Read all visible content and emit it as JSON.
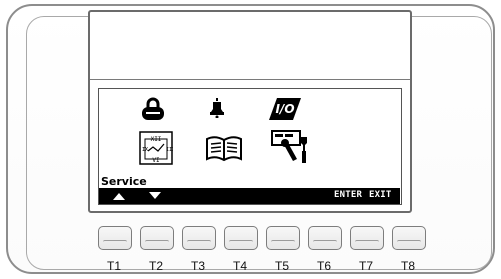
{
  "screen": {
    "menu_label": "Service",
    "icons": [
      {
        "name": "lock-icon"
      },
      {
        "name": "bell-icon"
      },
      {
        "name": "io-icon",
        "text": "I/O"
      },
      {
        "name": "clock-icon"
      },
      {
        "name": "book-icon"
      },
      {
        "name": "tools-icon"
      }
    ],
    "softkeys": {
      "up": "▲",
      "down": "▼",
      "enter": "ENTER",
      "exit": "EXIT"
    }
  },
  "keys": [
    "T1",
    "T2",
    "T3",
    "T4",
    "T5",
    "T6",
    "T7",
    "T8"
  ]
}
